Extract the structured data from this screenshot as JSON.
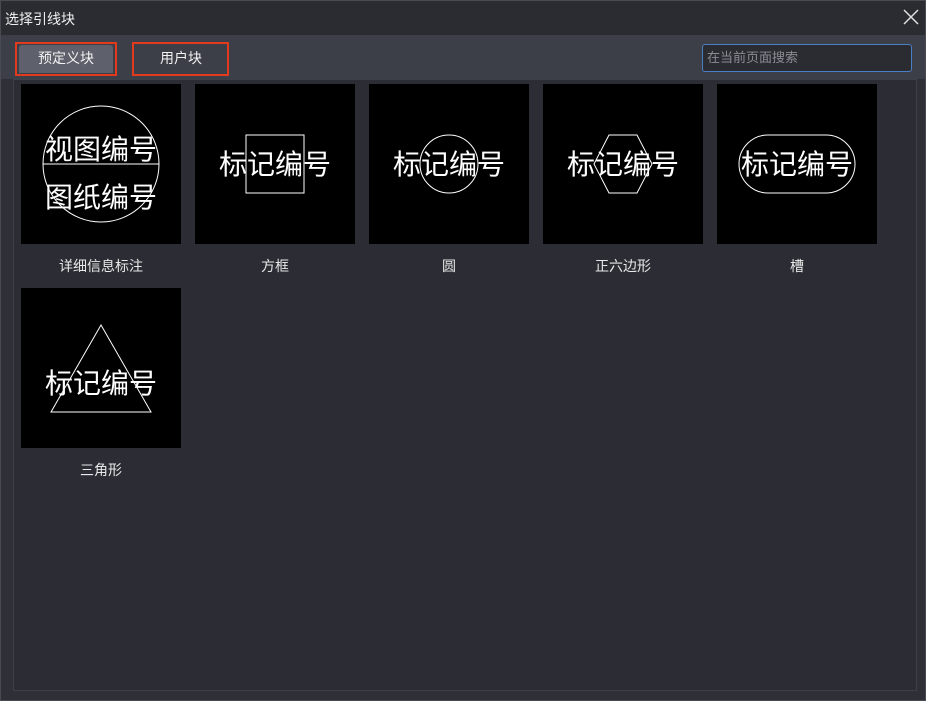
{
  "window": {
    "title": "选择引线块"
  },
  "tabs": [
    {
      "label": "预定义块",
      "active": true
    },
    {
      "label": "用户块",
      "active": false
    }
  ],
  "search": {
    "placeholder": "在当前页面搜索",
    "value": ""
  },
  "blocks": [
    {
      "caption": "详细信息标注",
      "shape": "circle-split",
      "lines": [
        "视图编号",
        "图纸编号"
      ]
    },
    {
      "caption": "方框",
      "shape": "square",
      "lines": [
        "标记编号"
      ]
    },
    {
      "caption": "圆",
      "shape": "circle",
      "lines": [
        "标记编号"
      ]
    },
    {
      "caption": "正六边形",
      "shape": "hexagon",
      "lines": [
        "标记编号"
      ]
    },
    {
      "caption": "槽",
      "shape": "slot",
      "lines": [
        "标记编号"
      ]
    },
    {
      "caption": "三角形",
      "shape": "triangle",
      "lines": [
        "标记编号"
      ]
    }
  ],
  "colors": {
    "highlight": "#e23a1f",
    "accent": "#4a7fc2"
  }
}
